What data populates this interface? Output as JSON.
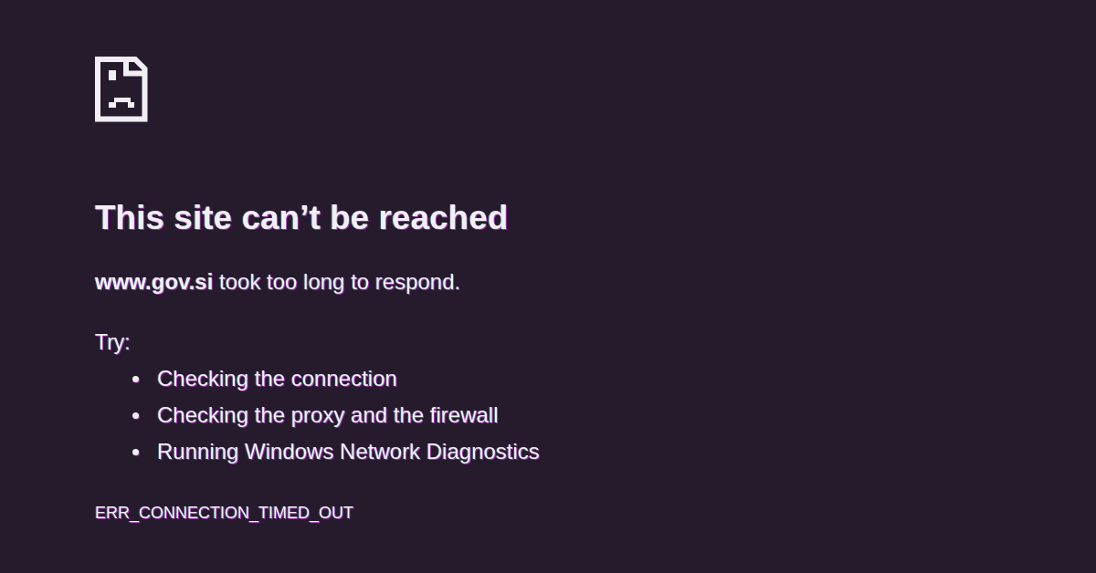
{
  "error_page": {
    "heading": "This site can’t be reached",
    "message": "**www.gov.si** took too long to respond.",
    "suggestions": {
      "intro": "Try:",
      "items": [
        "Checking the connection",
        "Checking the proxy and the firewall",
        "Running Windows Network Diagnostics"
      ]
    },
    "error_code": "ERR_CONNECTION_TIMED_OUT"
  }
}
